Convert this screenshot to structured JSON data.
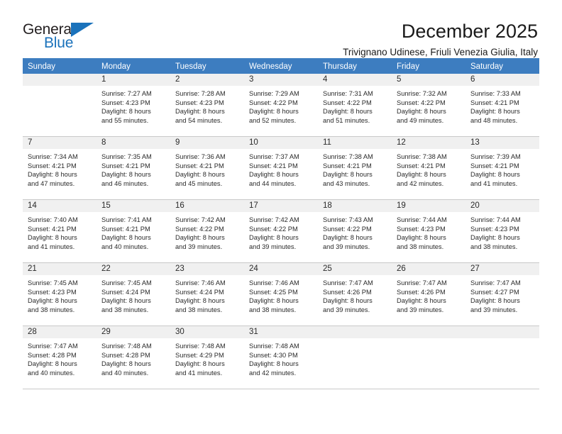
{
  "brand": {
    "name_part1": "General",
    "name_part2": "Blue",
    "triangle_color": "#1a72bb"
  },
  "header": {
    "title": "December 2025",
    "subtitle": "Trivignano Udinese, Friuli Venezia Giulia, Italy"
  },
  "theme": {
    "header_blue": "#3d7dc0",
    "day_band_gray": "#f0f0f0",
    "grid_line": "#c9c9c9"
  },
  "weekdays": [
    "Sunday",
    "Monday",
    "Tuesday",
    "Wednesday",
    "Thursday",
    "Friday",
    "Saturday"
  ],
  "weeks": [
    [
      {
        "day": "",
        "sunrise": "",
        "sunset": "",
        "daylight1": "",
        "daylight2": ""
      },
      {
        "day": "1",
        "sunrise": "Sunrise: 7:27 AM",
        "sunset": "Sunset: 4:23 PM",
        "daylight1": "Daylight: 8 hours",
        "daylight2": "and 55 minutes."
      },
      {
        "day": "2",
        "sunrise": "Sunrise: 7:28 AM",
        "sunset": "Sunset: 4:23 PM",
        "daylight1": "Daylight: 8 hours",
        "daylight2": "and 54 minutes."
      },
      {
        "day": "3",
        "sunrise": "Sunrise: 7:29 AM",
        "sunset": "Sunset: 4:22 PM",
        "daylight1": "Daylight: 8 hours",
        "daylight2": "and 52 minutes."
      },
      {
        "day": "4",
        "sunrise": "Sunrise: 7:31 AM",
        "sunset": "Sunset: 4:22 PM",
        "daylight1": "Daylight: 8 hours",
        "daylight2": "and 51 minutes."
      },
      {
        "day": "5",
        "sunrise": "Sunrise: 7:32 AM",
        "sunset": "Sunset: 4:22 PM",
        "daylight1": "Daylight: 8 hours",
        "daylight2": "and 49 minutes."
      },
      {
        "day": "6",
        "sunrise": "Sunrise: 7:33 AM",
        "sunset": "Sunset: 4:21 PM",
        "daylight1": "Daylight: 8 hours",
        "daylight2": "and 48 minutes."
      }
    ],
    [
      {
        "day": "7",
        "sunrise": "Sunrise: 7:34 AM",
        "sunset": "Sunset: 4:21 PM",
        "daylight1": "Daylight: 8 hours",
        "daylight2": "and 47 minutes."
      },
      {
        "day": "8",
        "sunrise": "Sunrise: 7:35 AM",
        "sunset": "Sunset: 4:21 PM",
        "daylight1": "Daylight: 8 hours",
        "daylight2": "and 46 minutes."
      },
      {
        "day": "9",
        "sunrise": "Sunrise: 7:36 AM",
        "sunset": "Sunset: 4:21 PM",
        "daylight1": "Daylight: 8 hours",
        "daylight2": "and 45 minutes."
      },
      {
        "day": "10",
        "sunrise": "Sunrise: 7:37 AM",
        "sunset": "Sunset: 4:21 PM",
        "daylight1": "Daylight: 8 hours",
        "daylight2": "and 44 minutes."
      },
      {
        "day": "11",
        "sunrise": "Sunrise: 7:38 AM",
        "sunset": "Sunset: 4:21 PM",
        "daylight1": "Daylight: 8 hours",
        "daylight2": "and 43 minutes."
      },
      {
        "day": "12",
        "sunrise": "Sunrise: 7:38 AM",
        "sunset": "Sunset: 4:21 PM",
        "daylight1": "Daylight: 8 hours",
        "daylight2": "and 42 minutes."
      },
      {
        "day": "13",
        "sunrise": "Sunrise: 7:39 AM",
        "sunset": "Sunset: 4:21 PM",
        "daylight1": "Daylight: 8 hours",
        "daylight2": "and 41 minutes."
      }
    ],
    [
      {
        "day": "14",
        "sunrise": "Sunrise: 7:40 AM",
        "sunset": "Sunset: 4:21 PM",
        "daylight1": "Daylight: 8 hours",
        "daylight2": "and 41 minutes."
      },
      {
        "day": "15",
        "sunrise": "Sunrise: 7:41 AM",
        "sunset": "Sunset: 4:21 PM",
        "daylight1": "Daylight: 8 hours",
        "daylight2": "and 40 minutes."
      },
      {
        "day": "16",
        "sunrise": "Sunrise: 7:42 AM",
        "sunset": "Sunset: 4:22 PM",
        "daylight1": "Daylight: 8 hours",
        "daylight2": "and 39 minutes."
      },
      {
        "day": "17",
        "sunrise": "Sunrise: 7:42 AM",
        "sunset": "Sunset: 4:22 PM",
        "daylight1": "Daylight: 8 hours",
        "daylight2": "and 39 minutes."
      },
      {
        "day": "18",
        "sunrise": "Sunrise: 7:43 AM",
        "sunset": "Sunset: 4:22 PM",
        "daylight1": "Daylight: 8 hours",
        "daylight2": "and 39 minutes."
      },
      {
        "day": "19",
        "sunrise": "Sunrise: 7:44 AM",
        "sunset": "Sunset: 4:23 PM",
        "daylight1": "Daylight: 8 hours",
        "daylight2": "and 38 minutes."
      },
      {
        "day": "20",
        "sunrise": "Sunrise: 7:44 AM",
        "sunset": "Sunset: 4:23 PM",
        "daylight1": "Daylight: 8 hours",
        "daylight2": "and 38 minutes."
      }
    ],
    [
      {
        "day": "21",
        "sunrise": "Sunrise: 7:45 AM",
        "sunset": "Sunset: 4:23 PM",
        "daylight1": "Daylight: 8 hours",
        "daylight2": "and 38 minutes."
      },
      {
        "day": "22",
        "sunrise": "Sunrise: 7:45 AM",
        "sunset": "Sunset: 4:24 PM",
        "daylight1": "Daylight: 8 hours",
        "daylight2": "and 38 minutes."
      },
      {
        "day": "23",
        "sunrise": "Sunrise: 7:46 AM",
        "sunset": "Sunset: 4:24 PM",
        "daylight1": "Daylight: 8 hours",
        "daylight2": "and 38 minutes."
      },
      {
        "day": "24",
        "sunrise": "Sunrise: 7:46 AM",
        "sunset": "Sunset: 4:25 PM",
        "daylight1": "Daylight: 8 hours",
        "daylight2": "and 38 minutes."
      },
      {
        "day": "25",
        "sunrise": "Sunrise: 7:47 AM",
        "sunset": "Sunset: 4:26 PM",
        "daylight1": "Daylight: 8 hours",
        "daylight2": "and 39 minutes."
      },
      {
        "day": "26",
        "sunrise": "Sunrise: 7:47 AM",
        "sunset": "Sunset: 4:26 PM",
        "daylight1": "Daylight: 8 hours",
        "daylight2": "and 39 minutes."
      },
      {
        "day": "27",
        "sunrise": "Sunrise: 7:47 AM",
        "sunset": "Sunset: 4:27 PM",
        "daylight1": "Daylight: 8 hours",
        "daylight2": "and 39 minutes."
      }
    ],
    [
      {
        "day": "28",
        "sunrise": "Sunrise: 7:47 AM",
        "sunset": "Sunset: 4:28 PM",
        "daylight1": "Daylight: 8 hours",
        "daylight2": "and 40 minutes."
      },
      {
        "day": "29",
        "sunrise": "Sunrise: 7:48 AM",
        "sunset": "Sunset: 4:28 PM",
        "daylight1": "Daylight: 8 hours",
        "daylight2": "and 40 minutes."
      },
      {
        "day": "30",
        "sunrise": "Sunrise: 7:48 AM",
        "sunset": "Sunset: 4:29 PM",
        "daylight1": "Daylight: 8 hours",
        "daylight2": "and 41 minutes."
      },
      {
        "day": "31",
        "sunrise": "Sunrise: 7:48 AM",
        "sunset": "Sunset: 4:30 PM",
        "daylight1": "Daylight: 8 hours",
        "daylight2": "and 42 minutes."
      },
      {
        "day": "",
        "sunrise": "",
        "sunset": "",
        "daylight1": "",
        "daylight2": ""
      },
      {
        "day": "",
        "sunrise": "",
        "sunset": "",
        "daylight1": "",
        "daylight2": ""
      },
      {
        "day": "",
        "sunrise": "",
        "sunset": "",
        "daylight1": "",
        "daylight2": ""
      }
    ]
  ]
}
